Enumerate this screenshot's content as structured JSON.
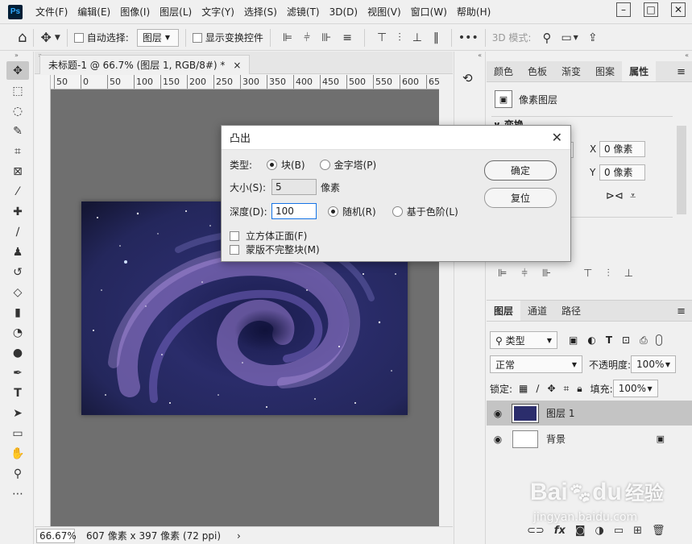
{
  "menu": {
    "logo": "Ps",
    "items": [
      "文件(F)",
      "编辑(E)",
      "图像(I)",
      "图层(L)",
      "文字(Y)",
      "选择(S)",
      "滤镜(T)",
      "3D(D)",
      "视图(V)",
      "窗口(W)",
      "帮助(H)"
    ]
  },
  "options": {
    "auto_select_label": "自动选择:",
    "auto_select_value": "图层",
    "show_transform_label": "显示变换控件",
    "mode_3d": "3D 模式:",
    "more": "•••"
  },
  "document": {
    "tab_title": "未标题-1 @ 66.7% (图层 1, RGB/8#) *",
    "tab_close": "×",
    "ruler_ticks": [
      "50",
      "0",
      "50",
      "100",
      "150",
      "200",
      "250",
      "300",
      "350",
      "400",
      "450",
      "500",
      "550",
      "600",
      "65"
    ],
    "zoom": "66.67%",
    "doc_info": "607 像素 x 397 像素 (72 ppi)",
    "status_arrow": "›"
  },
  "properties": {
    "tabs": [
      "颜色",
      "色板",
      "渐变",
      "图案",
      "属性"
    ],
    "active_tab": "属性",
    "layer_type": "像素图层",
    "transform_header": "变换",
    "x_label": "X",
    "x_value": "0 像素",
    "y_label": "Y",
    "y_value": "0 像素"
  },
  "layers": {
    "tabs": [
      "图层",
      "通道",
      "路径"
    ],
    "filter_kind": "类型",
    "blend_mode": "正常",
    "opacity_label": "不透明度:",
    "opacity_value": "100%",
    "lock_label": "锁定:",
    "fill_label": "填充:",
    "fill_value": "100%",
    "items": [
      {
        "name": "图层 1",
        "selected": true
      },
      {
        "name": "背景",
        "selected": false
      }
    ]
  },
  "dialog": {
    "title": "凸出",
    "type_label": "类型:",
    "type_block": "块(B)",
    "type_pyramid": "金字塔(P)",
    "size_label": "大小(S):",
    "size_value": "5",
    "size_unit": "像素",
    "depth_label": "深度(D):",
    "depth_value": "100",
    "depth_random": "随机(R)",
    "depth_level": "基于色阶(L)",
    "solid_front": "立方体正面(F)",
    "mask_incomplete": "蒙版不完整块(M)",
    "ok": "确定",
    "reset": "复位"
  },
  "watermark": {
    "brand": "Bai",
    "brand2": "du",
    "suffix": "经验",
    "url": "jingyan.baidu.com"
  }
}
